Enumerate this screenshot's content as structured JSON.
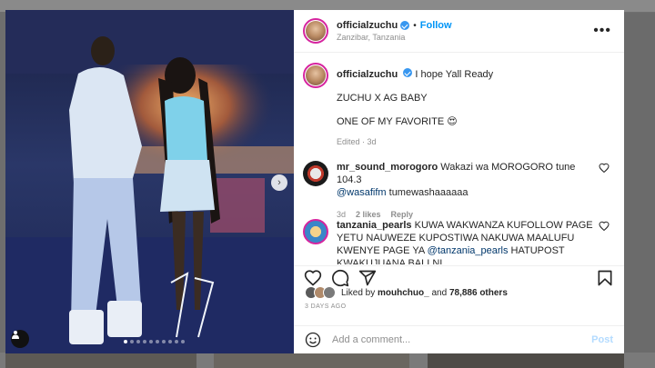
{
  "post": {
    "author": "officialzuchu",
    "follow_label": "Follow",
    "separator": "•",
    "location": "Zanzibar, Tanzania",
    "more_label": "•••",
    "next_label": "›",
    "carousel": {
      "total": 10,
      "active": 0
    }
  },
  "caption": {
    "author": "officialzuchu",
    "line1": "I hope Yall Ready",
    "line2": "ZUCHU X AG BABY",
    "line3": "ONE OF MY FAVORITE 😍",
    "edited": "Edited · 3d"
  },
  "comments": [
    {
      "user": "mr_sound_morogoro",
      "text": "Wakazi wa MOROGORO tune 104.3",
      "mention": "@wasafifm",
      "text_after": " tumewashaaaaaa",
      "time": "3d",
      "likes": "2 likes",
      "reply": "Reply"
    },
    {
      "user": "tanzania_pearls",
      "text": "KUWA WAKWANZA KUFOLLOW PAGE YETU NAUWEZE KUPOSTIWA NAKUWA MAALUFU KWENYE PAGE YA",
      "mention": "@tanzania_pearls",
      "text_after": " HATUPOST KWAKUJUANA BALI NI"
    }
  ],
  "likes": {
    "prefix": "Liked by",
    "first": "mouhchuo_",
    "middle": "and",
    "others": "78,886 others"
  },
  "date": "3 DAYS AGO",
  "add_comment": {
    "placeholder": "Add a comment...",
    "post_label": "Post"
  },
  "colors": {
    "accent": "#0095f6",
    "verified": "#3897f0",
    "post_disabled": "#b3dbff"
  },
  "icons": [
    "heart-icon",
    "comment-icon",
    "share-icon",
    "bookmark-icon",
    "emoji-icon",
    "user-tag-icon",
    "more-icon",
    "chevron-right-icon",
    "verified-badge-icon"
  ]
}
